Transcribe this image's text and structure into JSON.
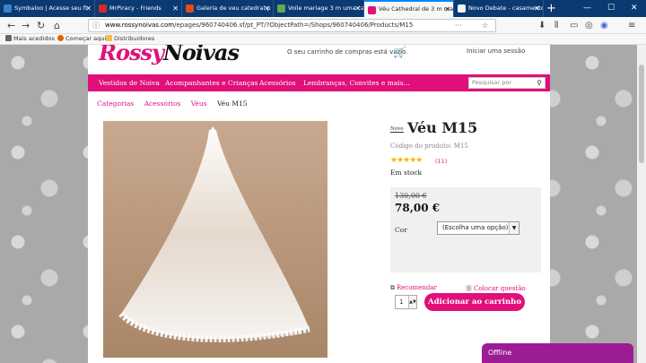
{
  "browser": {
    "tabs": [
      {
        "title": "Symbaloo | Acesse seu fi",
        "color": "#3b82c4"
      },
      {
        "title": "MrPiracy - Friends",
        "color": "#d12a2a"
      },
      {
        "title": "Galeria de veu catedral p",
        "color": "#e24a1f"
      },
      {
        "title": "Voile mariage 3 m uma cam",
        "color": "#6aa84f"
      },
      {
        "title": "Véu Cathedral de 3 m ma",
        "color": "#e0107a"
      },
      {
        "title": "Novo Debate - casamento",
        "color": "#f4f4f4"
      }
    ],
    "new_tab": "+",
    "window_controls": {
      "minimize": "—",
      "maximize": "☐",
      "close": "✕"
    },
    "nav": {
      "back": "←",
      "forward": "→",
      "reload": "↻",
      "home": "⌂"
    },
    "url_domain": "www.rossynoivas.com",
    "url_path": "/epages/960740406.sf/pt_PT/?ObjectPath=/Shops/960740406/Products/M15",
    "page_icons": {
      "more": "···",
      "bookmark": "☆"
    },
    "toolbar_icons": {
      "download": "⬇",
      "library": "⫴",
      "sidebar": "▭",
      "account": "◎",
      "extension": "◉",
      "menu": "≡"
    },
    "bookmarks": [
      {
        "label": "Mais acedidos",
        "color": "#666"
      },
      {
        "label": "Começar aqui",
        "color": "#e66000"
      },
      {
        "label": "Distribuidores",
        "color": "#f0c050"
      }
    ]
  },
  "site": {
    "logo_main": "Rossy",
    "logo_accent": "Noivas",
    "cart_text": "O seu carrinho de compras está vazio.",
    "cart_icon": "🛒",
    "login": "Iniciar uma sessão",
    "menu": [
      "Vestidos de Noiva",
      "Acompanhantes e Crianças",
      "Acessórios",
      "Lembranças, Convites e mais..."
    ],
    "search_placeholder": "Pesquisar por",
    "search_icon": "⚲",
    "brand_color": "#e0107a"
  },
  "breadcrumbs": [
    "Categorias",
    "Acessórios",
    "Véus",
    "Véu M15"
  ],
  "product": {
    "badge": "Novo",
    "title": "Véu M15",
    "code": "Código do produto: M15",
    "stars": "★★★★★",
    "rating": 5,
    "rating_count": "(11)",
    "stock": "Em stock",
    "old_price": "130,00 €",
    "price": "78,00 €",
    "color_label": "Cor",
    "color_select": "(Escolha uma opção)",
    "quantity": "1",
    "add_to_cart": "Adicionar ao carrinho",
    "recommend": "Recomendar",
    "ask": "Colocar questão"
  },
  "chat": {
    "label": "Offline"
  }
}
